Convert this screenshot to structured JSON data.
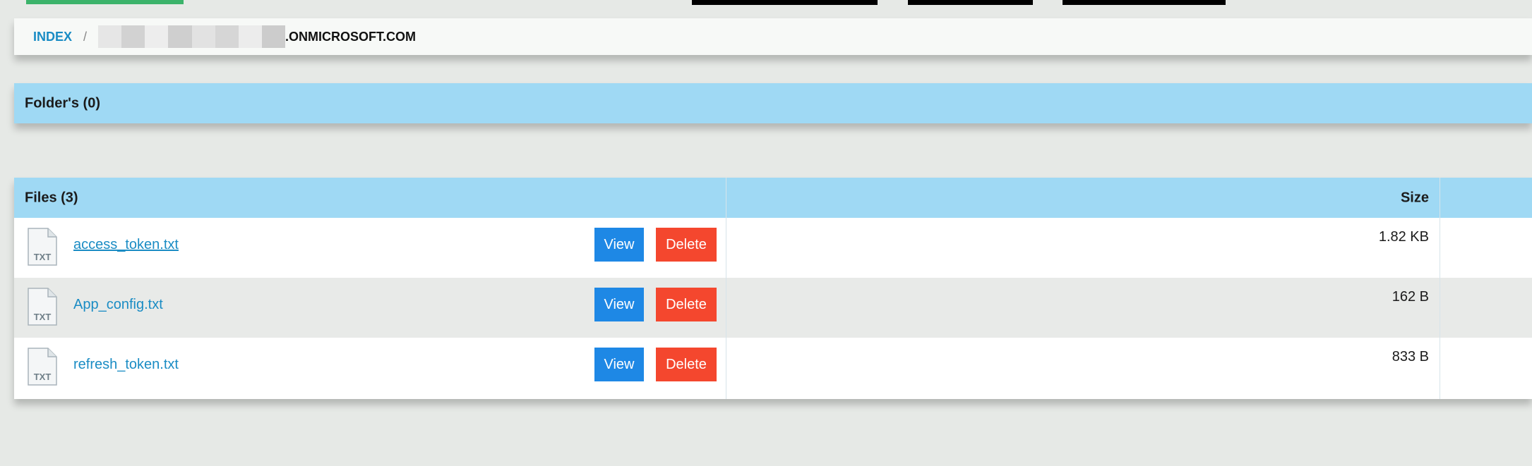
{
  "breadcrumb": {
    "index_label": "INDEX",
    "separator": "/",
    "domain_suffix": ".ONMICROSOFT.COM"
  },
  "folders": {
    "title": "Folder's (0)"
  },
  "files": {
    "title": "Files (3)",
    "size_header": "Size",
    "view_label": "View",
    "delete_label": "Delete",
    "icon_label": "TXT",
    "items": [
      {
        "name": "access_token.txt",
        "size": "1.82 KB"
      },
      {
        "name": "App_config.txt",
        "size": "162 B"
      },
      {
        "name": "refresh_token.txt",
        "size": "833 B"
      }
    ]
  },
  "colors": {
    "header_bg": "#9fd9f4",
    "link": "#1a8cc4",
    "view_button": "#1e88e5",
    "delete_button": "#f4472e"
  }
}
